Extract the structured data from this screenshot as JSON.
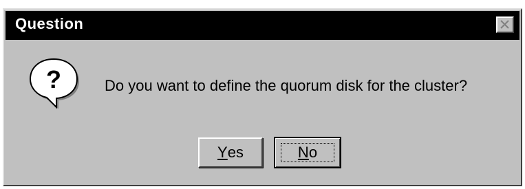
{
  "dialog": {
    "title": "Question",
    "message": "Do you want to define the quorum disk for the cluster?",
    "icon": "question-icon",
    "close_icon": "close-icon",
    "buttons": {
      "yes": {
        "mnemonic": "Y",
        "rest": "es"
      },
      "no": {
        "mnemonic": "N",
        "rest": "o"
      }
    },
    "default_button": "No"
  },
  "colors": {
    "titlebar": "#000000",
    "title_text": "#ffffff",
    "dialog_face": "#c0c0c0"
  }
}
